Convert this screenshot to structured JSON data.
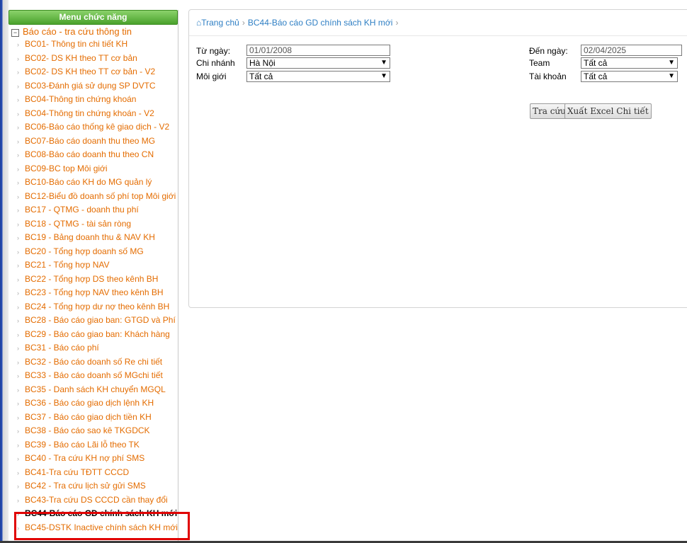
{
  "sidebar": {
    "header": "Menu chức năng",
    "root_label": "Báo cáo - tra cứu thông tin",
    "items": [
      {
        "label": "BC01- Thông tin chi tiết KH"
      },
      {
        "label": "BC02- DS KH theo TT cơ bản"
      },
      {
        "label": "BC02- DS KH theo TT cơ bản - V2"
      },
      {
        "label": "BC03-Đánh giá sử dụng SP DVTC"
      },
      {
        "label": "BC04-Thông tin chứng khoán"
      },
      {
        "label": "BC04-Thông tin chứng khoán - V2"
      },
      {
        "label": "BC06-Báo cáo thống kê giao dịch - V2"
      },
      {
        "label": "BC07-Báo cáo doanh thu theo MG"
      },
      {
        "label": "BC08-Báo cáo doanh thu theo CN"
      },
      {
        "label": "BC09-BC top Môi giới"
      },
      {
        "label": "BC10-Báo cáo KH do MG quản lý"
      },
      {
        "label": "BC12-Biểu đồ doanh số phí top Môi giới"
      },
      {
        "label": "BC17 - QTMG - doanh thu phí"
      },
      {
        "label": "BC18 - QTMG - tài sản ròng"
      },
      {
        "label": "BC19 - Bảng doanh thu & NAV KH"
      },
      {
        "label": "BC20 - Tổng hợp doanh số MG"
      },
      {
        "label": "BC21 - Tổng hợp NAV"
      },
      {
        "label": "BC22 - Tổng hợp DS theo kênh BH"
      },
      {
        "label": "BC23 - Tổng hợp NAV theo kênh BH"
      },
      {
        "label": "BC24 - Tổng hợp dư nợ theo kênh BH"
      },
      {
        "label": "BC28 - Báo cáo giao ban: GTGD và Phí"
      },
      {
        "label": "BC29 - Báo cáo giao ban: Khách hàng"
      },
      {
        "label": "BC31 - Báo cáo phí"
      },
      {
        "label": "BC32 - Báo cáo doanh số Re chi tiết"
      },
      {
        "label": "BC33 - Báo cáo doanh số MGchi tiết"
      },
      {
        "label": "BC35 - Danh sách KH chuyển MGQL"
      },
      {
        "label": "BC36 - Báo cáo giao dịch lệnh KH"
      },
      {
        "label": "BC37 - Báo cáo giao dịch tiền KH"
      },
      {
        "label": "BC38 - Báo cáo sao kê TKGDCK"
      },
      {
        "label": "BC39 - Báo cáo Lãi lỗ theo TK"
      },
      {
        "label": "BC40 - Tra cứu KH nợ phí SMS"
      },
      {
        "label": "BC41-Tra cứu TĐTT CCCD"
      },
      {
        "label": "BC42 - Tra cứu lịch sử gửi SMS"
      },
      {
        "label": "BC43-Tra cứu DS CCCD cần thay đổi"
      },
      {
        "label": "BC44-Báo cáo GD chính sách KH mới"
      },
      {
        "label": "BC45-DSTK Inactive chính sách KH mới"
      }
    ]
  },
  "breadcrumb": {
    "home": "Trang chủ",
    "current": "BC44-Báo cáo GD chính sách KH mới",
    "separator": "›"
  },
  "form": {
    "from_date_label": "Từ ngày:",
    "from_date_value": "01/01/2008",
    "to_date_label": "Đến ngày:",
    "to_date_value": "02/04/2025",
    "branch_label": "Chi nhánh",
    "branch_value": "Hà Nội",
    "team_label": "Team",
    "team_value": "Tất cả",
    "broker_label": "Môi giới",
    "broker_value": "Tất cả",
    "account_label": "Tài khoản",
    "account_value": "Tất cả"
  },
  "buttons": {
    "search": "Tra cứu",
    "export": "Xuất Excel Chi tiết"
  },
  "colors": {
    "menu_link": "#e46c00",
    "breadcrumb_link": "#2f7fc4",
    "header_green": "#4aa22c",
    "highlight": "#e00000"
  }
}
